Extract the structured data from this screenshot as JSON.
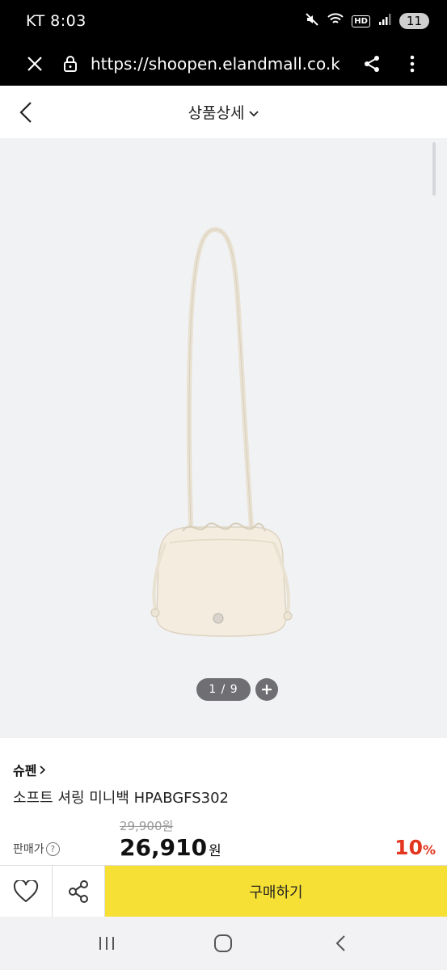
{
  "status_bar": {
    "carrier_time": "KT 8:03",
    "hd": "HD",
    "notification_count": "11",
    "icons": [
      "mute-icon",
      "wifi-icon",
      "signal-icon"
    ]
  },
  "browser": {
    "url": "https://shoopen.elandmall.co.kr/i",
    "icons": [
      "close-icon",
      "lock-icon",
      "share-icon",
      "more-vert-icon"
    ]
  },
  "header": {
    "title": "상품상세",
    "icons": [
      "back-arrow-icon",
      "chevron-down-icon"
    ]
  },
  "gallery": {
    "pager": "1 / 9",
    "current_image": 1,
    "total_images": 9
  },
  "product": {
    "brand": "슈펜",
    "name": "소프트 셔링 미니백 HPABGFS302"
  },
  "price": {
    "label": "판매가",
    "help": "?",
    "original": "29,900원",
    "final_amount": "26,910",
    "final_unit": "원",
    "discount_num": "10",
    "discount_pct": "%"
  },
  "actions": {
    "buy_label": "구매하기",
    "icons": [
      "heart-icon",
      "share-icon"
    ]
  },
  "colors": {
    "buy_button": "#f7e035",
    "discount": "#e2361f",
    "image_bg": "#f1f2f4"
  }
}
